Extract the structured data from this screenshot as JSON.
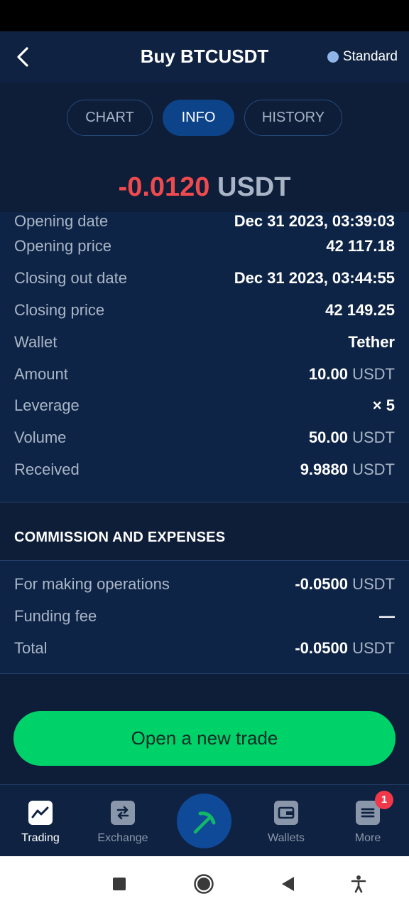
{
  "header": {
    "title": "Buy BTCUSDT",
    "account_type": "Standard"
  },
  "tabs": [
    {
      "label": "CHART"
    },
    {
      "label": "INFO"
    },
    {
      "label": "HISTORY"
    }
  ],
  "result": {
    "value": "-0.0120",
    "unit": "USDT"
  },
  "details": [
    {
      "label": "Opening date",
      "value": "Dec 31 2023, 03:39:03",
      "unit": ""
    },
    {
      "label": "Opening price",
      "value": "42 117.18",
      "unit": ""
    },
    {
      "label": "Closing out date",
      "value": "Dec 31 2023, 03:44:55",
      "unit": ""
    },
    {
      "label": "Closing price",
      "value": "42 149.25",
      "unit": ""
    },
    {
      "label": "Wallet",
      "value": "Tether",
      "unit": ""
    },
    {
      "label": "Amount",
      "value": "10.00",
      "unit": "USDT"
    },
    {
      "label": "Leverage",
      "value": "× 5",
      "unit": ""
    },
    {
      "label": "Volume",
      "value": "50.00",
      "unit": "USDT"
    },
    {
      "label": "Received",
      "value": "9.9880",
      "unit": "USDT"
    }
  ],
  "commission": {
    "title": "COMMISSION AND EXPENSES",
    "rows": [
      {
        "label": "For making operations",
        "value": "-0.0500",
        "unit": "USDT"
      },
      {
        "label": "Funding fee",
        "value": "—",
        "unit": ""
      },
      {
        "label": "Total",
        "value": "-0.0500",
        "unit": "USDT"
      }
    ]
  },
  "action": {
    "open_trade_label": "Open a new trade"
  },
  "bottom_nav": {
    "items": [
      {
        "label": "Trading",
        "icon": "trading-chart-icon"
      },
      {
        "label": "Exchange",
        "icon": "exchange-arrows-icon"
      },
      {
        "label": "Wallets",
        "icon": "wallet-icon"
      },
      {
        "label": "More",
        "icon": "menu-icon",
        "badge": "1"
      }
    ],
    "center_icon": "pickaxe-icon"
  },
  "colors": {
    "negative": "#ef4a4e",
    "accent_green": "#00d26a",
    "active_tab": "#0d4389",
    "badge": "#f0384a"
  }
}
